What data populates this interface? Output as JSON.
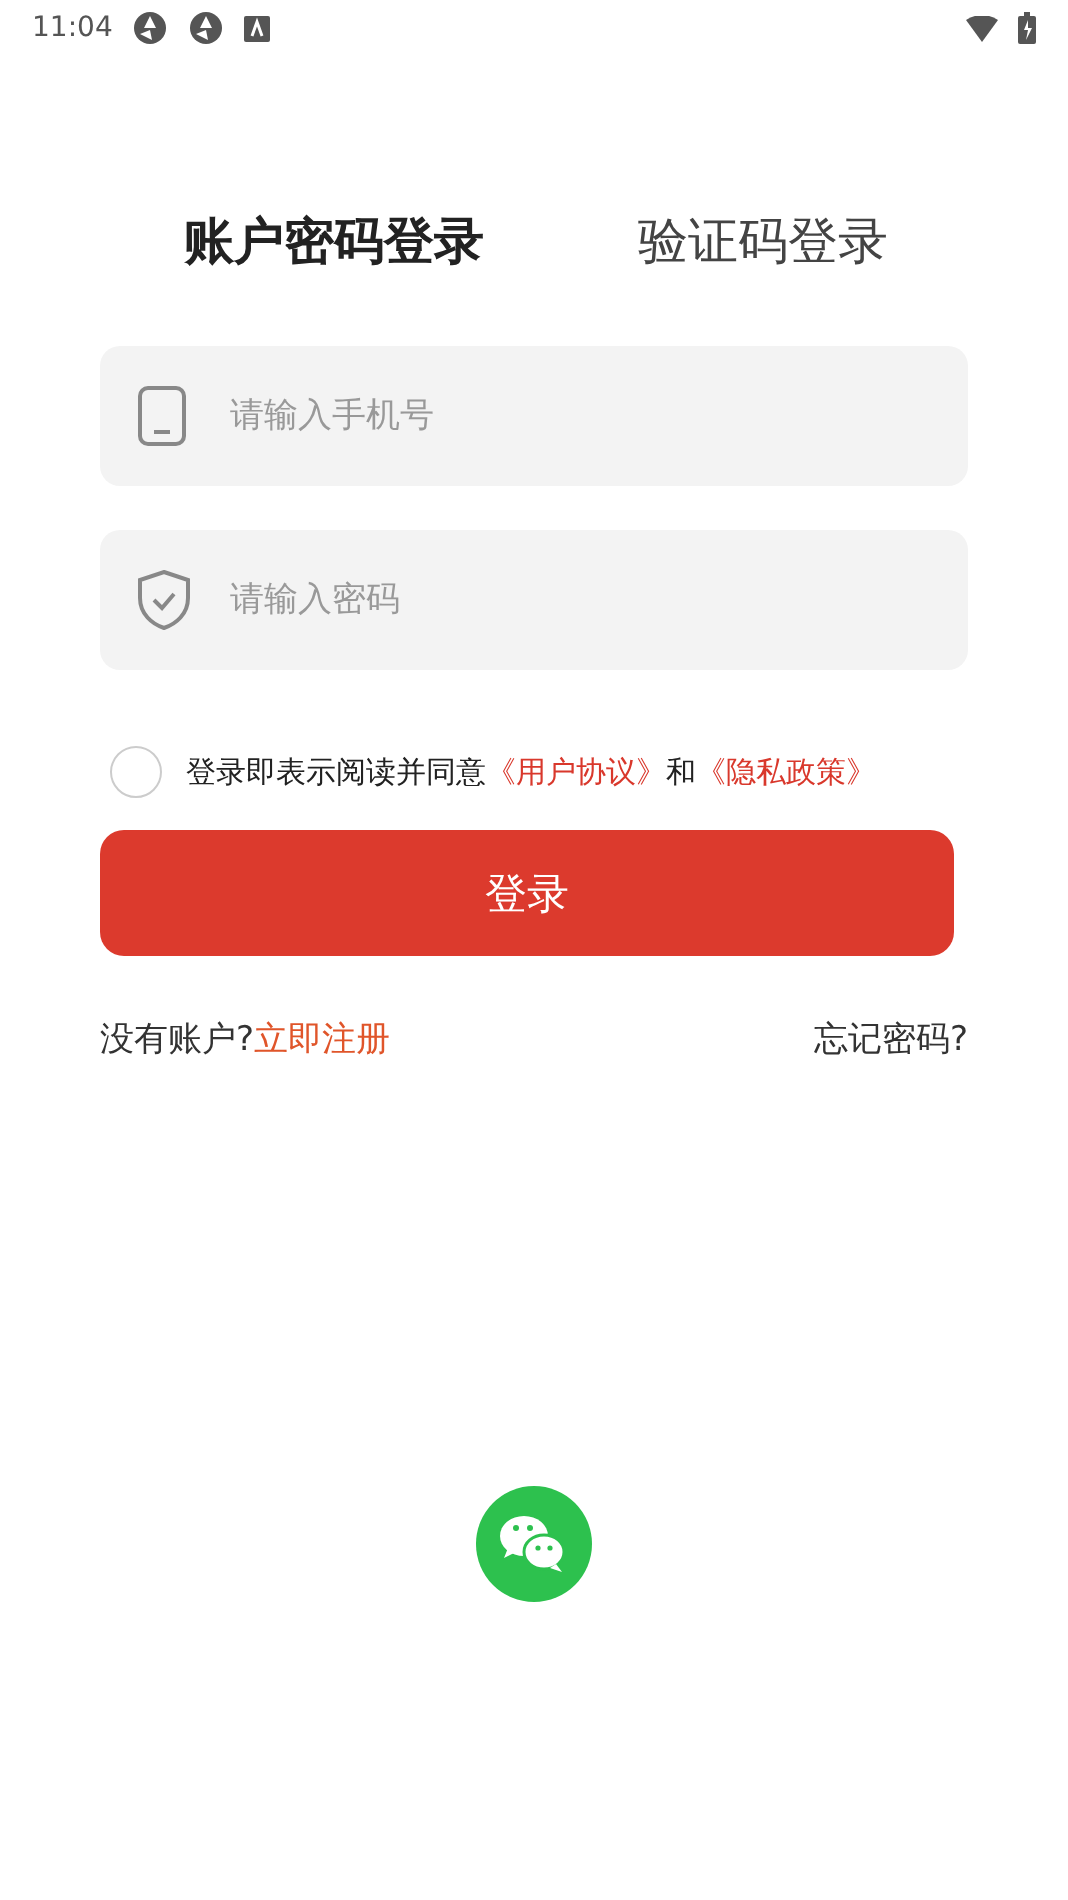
{
  "status_bar": {
    "time": "11:04"
  },
  "tabs": [
    {
      "label": "账户密码登录",
      "selected": true
    },
    {
      "label": "验证码登录",
      "selected": false
    }
  ],
  "fields": [
    {
      "kind": "phone",
      "placeholder": "请输入手机号"
    },
    {
      "kind": "password",
      "placeholder": "请输入密码"
    }
  ],
  "agreement": {
    "checked": false,
    "parts": [
      {
        "kind": "text",
        "text": "登录即表示阅读并同意"
      },
      {
        "kind": "link",
        "text": "《用户协议》"
      },
      {
        "kind": "text",
        "text": "和"
      },
      {
        "kind": "link",
        "text": "《隐私政策》"
      }
    ]
  },
  "login_button": "登录",
  "register": {
    "prompt": "没有账户?",
    "link": "立即注册"
  },
  "forgot_password": "忘记密码?"
}
